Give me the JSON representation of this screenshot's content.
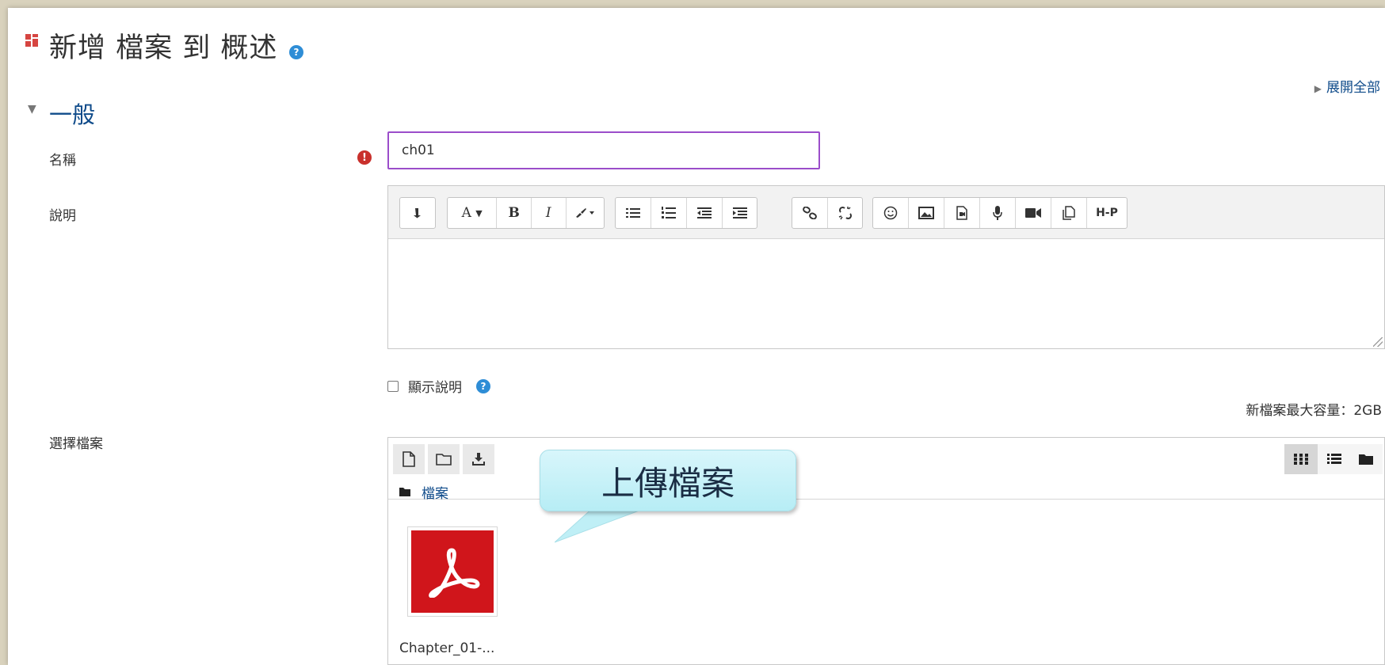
{
  "page": {
    "title": "新增 檔案 到 概述",
    "expand_all": "展開全部"
  },
  "section": {
    "title": "一般"
  },
  "form": {
    "name_label": "名稱",
    "name_value": "ch01",
    "description_label": "說明",
    "show_description_label": "顯示說明",
    "select_files_label": "選擇檔案",
    "max_file_size": "新檔案最大容量：2GB"
  },
  "editor": {
    "toolbar_icons": [
      "toggle-toolbar-icon",
      "font-style-icon",
      "bold-icon",
      "italic-icon",
      "text-color-icon",
      "unordered-list-icon",
      "ordered-list-icon",
      "outdent-icon",
      "indent-icon",
      "link-icon",
      "unlink-icon",
      "emoticon-icon",
      "image-icon",
      "media-icon",
      "record-audio-icon",
      "record-video-icon",
      "manage-files-icon",
      "h5p-icon"
    ],
    "bold_label": "B",
    "italic_label": "I",
    "font_label": "A",
    "h5p_label": "H-P"
  },
  "filemanager": {
    "path_label": "檔案",
    "files": [
      {
        "name": "Chapter_01-...",
        "type": "pdf"
      }
    ]
  },
  "annotation": {
    "callout_text": "上傳檔案"
  },
  "colors": {
    "accent": "#0f4b8a",
    "focus_border": "#9b4dca",
    "required": "#c9302c",
    "help": "#2e8dd6",
    "pdf_red": "#d0151b",
    "callout": "#c6f1f8"
  }
}
